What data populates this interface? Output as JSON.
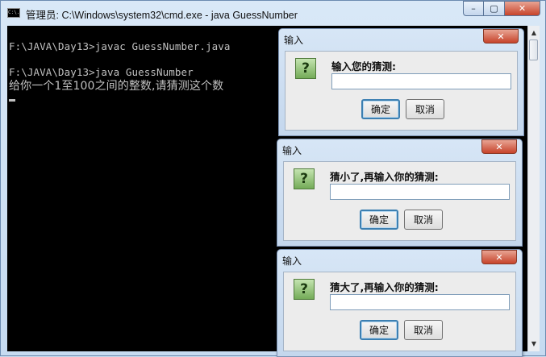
{
  "cmd": {
    "icon_text": "C:\\.",
    "title": "管理员: C:\\Windows\\system32\\cmd.exe - java  GuessNumber",
    "buttons": {
      "minimize": "–",
      "maximize": "▢",
      "close": "✕"
    },
    "lines": [
      "F:\\JAVA\\Day13>javac GuessNumber.java",
      "F:\\JAVA\\Day13>java GuessNumber",
      "给你一个1至100之间的整数,请猜测这个数"
    ]
  },
  "scrollbar": {
    "up": "▲",
    "down": "▼"
  },
  "dialogs": [
    {
      "title": "输入",
      "close": "✕",
      "icon": "?",
      "prompt": "输入您的猜测:",
      "value": "",
      "ok": "确定",
      "cancel": "取消"
    },
    {
      "title": "输入",
      "close": "✕",
      "icon": "?",
      "prompt": "猜小了,再输入你的猜测:",
      "value": "",
      "ok": "确定",
      "cancel": "取消"
    },
    {
      "title": "输入",
      "close": "✕",
      "icon": "?",
      "prompt": "猜大了,再输入你的猜测:",
      "value": "",
      "ok": "确定",
      "cancel": "取消"
    }
  ]
}
